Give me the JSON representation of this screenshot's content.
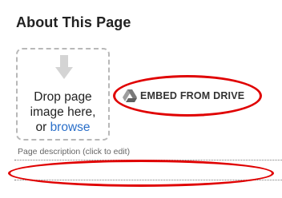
{
  "section": {
    "title": "About This Page"
  },
  "dropzone": {
    "line1": "Drop page",
    "line2": "image here,",
    "line3_prefix": "or ",
    "browse_link": "browse",
    "icon": "down-arrow-icon"
  },
  "embed": {
    "label": "EMBED FROM DRIVE",
    "icon": "google-drive-icon"
  },
  "description": {
    "label": "Page description (click to edit)",
    "value": ""
  },
  "colors": {
    "link": "#2a6fc9",
    "annotation": "#e00000"
  }
}
